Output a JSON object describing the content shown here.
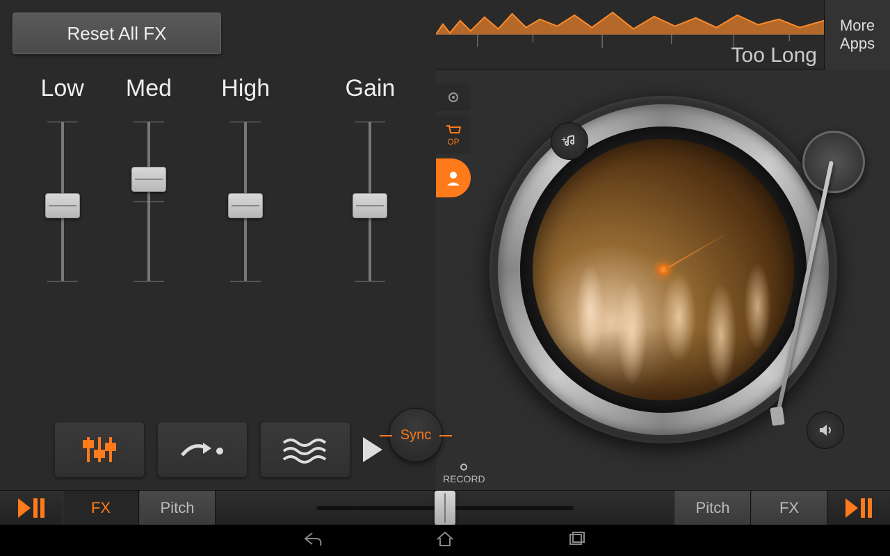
{
  "fx": {
    "reset_label": "Reset All FX",
    "sliders": [
      {
        "label": "Low",
        "pos": 0.45
      },
      {
        "label": "Med",
        "pos": 0.3
      },
      {
        "label": "High",
        "pos": 0.45
      },
      {
        "label": "Gain",
        "pos": 0.45
      }
    ],
    "buttons": {
      "eq_active": true,
      "sync_label": "Sync"
    }
  },
  "deck": {
    "track_title": "Too Long",
    "more_apps_label": "More\nApps",
    "side": {
      "shop_label": "OP"
    },
    "record_label": "RECORD"
  },
  "bottom": {
    "fx_label": "FX",
    "pitch_label": "Pitch",
    "crossfader_pos": 0.5
  },
  "colors": {
    "accent": "#ff7a1a"
  }
}
